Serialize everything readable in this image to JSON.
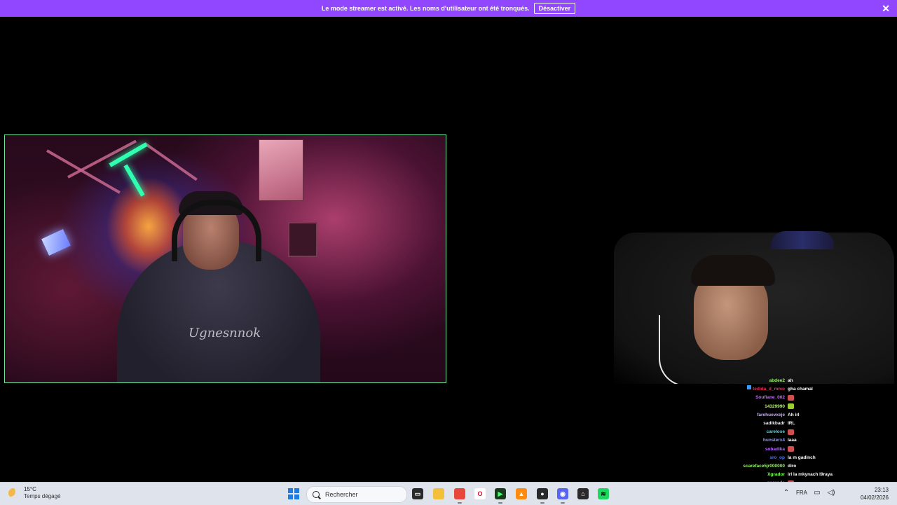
{
  "banner": {
    "message": "Le mode streamer est activé. Les noms d'utilisateur ont été tronqués.",
    "disable_label": "Désactiver",
    "close_label": "✕",
    "color": "#9146ff"
  },
  "left_cam": {
    "hoodie_text": "Ugnesnnok",
    "border_color": "#6ee39a"
  },
  "chat": {
    "messages": [
      {
        "user": "abdee2",
        "color": "#9bf070",
        "text": "ah",
        "emote": false
      },
      {
        "user": "tedida_d_mmo",
        "color": "#e0305a",
        "text": "gha chamal",
        "emote": false,
        "badges": true
      },
      {
        "user": "Soufiane_002",
        "color": "#c86bff",
        "text": "",
        "emote": true,
        "emote_color": "#d05050"
      },
      {
        "user": "14329990",
        "color": "#b5f06a",
        "text": "",
        "emote": true,
        "emote_color": "#9acd32"
      },
      {
        "user": "farehuevxeje",
        "color": "#cda7ff",
        "text": "Ah irl",
        "emote": false
      },
      {
        "user": "sadikbadr",
        "color": "#f0f0f0",
        "text": "IRL",
        "emote": false
      },
      {
        "user": "carelose",
        "color": "#5adce8",
        "text": "",
        "emote": true,
        "emote_color": "#d05050"
      },
      {
        "user": "hunsterx4",
        "color": "#8a9aff",
        "text": "laaa",
        "emote": false
      },
      {
        "user": "sobadika",
        "color": "#b36bff",
        "text": "",
        "emote": true,
        "emote_color": "#d05050"
      },
      {
        "user": "sro_op",
        "color": "#4f7bff",
        "text": "la m gadinch",
        "emote": false
      },
      {
        "user": "scareface5jr000000",
        "color": "#9bf070",
        "text": "diro",
        "emote": false
      },
      {
        "user": "Xgrador",
        "color": "#7cff5a",
        "text": "irl la mkynach l9raya",
        "emote": false
      },
      {
        "user": "gagrode",
        "color": "#d08a4a",
        "text": "",
        "emote": true,
        "emote_color": "#d05050"
      }
    ]
  },
  "taskbar": {
    "weather_temp": "15°C",
    "weather_desc": "Temps dégagé",
    "search_label": "Rechercher",
    "language": "FRA",
    "time": "23:13",
    "date": "04/02/2026",
    "apps": [
      {
        "name": "task-view-icon",
        "glyph": "▭",
        "bg": "#2a2a2a",
        "fg": "#ffffff"
      },
      {
        "name": "file-explorer-icon",
        "glyph": "",
        "bg": "#f3c03e",
        "fg": "#7a5a10"
      },
      {
        "name": "chrome-icon",
        "glyph": "",
        "bg": "#e8453c",
        "fg": "#ffffff"
      },
      {
        "name": "opera-icon",
        "glyph": "O",
        "bg": "#ffffff",
        "fg": "#e0102a"
      },
      {
        "name": "terminal-app-icon",
        "glyph": "▶",
        "bg": "#1b3a1b",
        "fg": "#3cff6a"
      },
      {
        "name": "vlc-icon",
        "glyph": "▲",
        "bg": "#ff8c10",
        "fg": "#ffffff"
      },
      {
        "name": "obs-icon",
        "glyph": "●",
        "bg": "#2a2a2a",
        "fg": "#ffffff"
      },
      {
        "name": "discord-icon",
        "glyph": "◉",
        "bg": "#5865f2",
        "fg": "#ffffff"
      },
      {
        "name": "store-icon",
        "glyph": "⌂",
        "bg": "#2a2a2a",
        "fg": "#ffffff"
      },
      {
        "name": "spotify-icon",
        "glyph": "≋",
        "bg": "#1ed760",
        "fg": "#000000"
      }
    ]
  }
}
